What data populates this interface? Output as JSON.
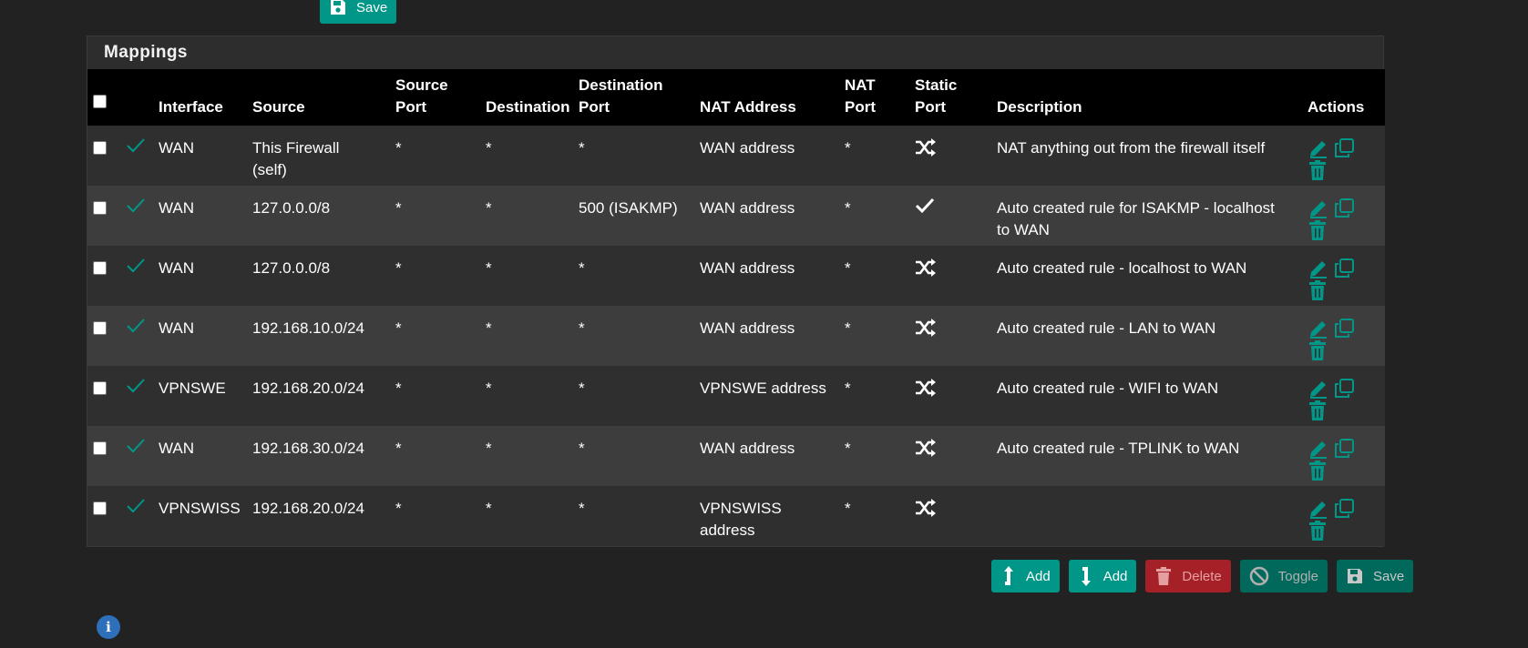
{
  "top_save": {
    "label": "Save"
  },
  "panel": {
    "title": "Mappings"
  },
  "columns": {
    "interface": "Interface",
    "source": "Source",
    "source_port": [
      "Source",
      "Port"
    ],
    "destination": "Destination",
    "destination_port": [
      "Destination",
      "Port"
    ],
    "nat_address": "NAT Address",
    "nat_port": [
      "NAT",
      "Port"
    ],
    "static_port": [
      "Static",
      "Port"
    ],
    "description": "Description",
    "actions": "Actions"
  },
  "rows": [
    {
      "interface": "WAN",
      "source": [
        "This Firewall",
        "(self)"
      ],
      "source_port": "*",
      "destination": "*",
      "destination_port": "*",
      "nat_address": [
        "WAN address"
      ],
      "nat_port": "*",
      "static_port_icon": "shuffle-icon",
      "description": [
        "NAT anything out from the firewall itself"
      ]
    },
    {
      "interface": "WAN",
      "source": [
        "127.0.0.0/8"
      ],
      "source_port": "*",
      "destination": "*",
      "destination_port": "500 (ISAKMP)",
      "nat_address": [
        "WAN address"
      ],
      "nat_port": "*",
      "static_port_icon": "check-icon",
      "description": [
        "Auto created rule for ISAKMP - localhost",
        "to WAN"
      ]
    },
    {
      "interface": "WAN",
      "source": [
        "127.0.0.0/8"
      ],
      "source_port": "*",
      "destination": "*",
      "destination_port": "*",
      "nat_address": [
        "WAN address"
      ],
      "nat_port": "*",
      "static_port_icon": "shuffle-icon",
      "description": [
        "Auto created rule - localhost to WAN"
      ]
    },
    {
      "interface": "WAN",
      "source": [
        "192.168.10.0/24"
      ],
      "source_port": "*",
      "destination": "*",
      "destination_port": "*",
      "nat_address": [
        "WAN address"
      ],
      "nat_port": "*",
      "static_port_icon": "shuffle-icon",
      "description": [
        "Auto created rule - LAN to WAN"
      ]
    },
    {
      "interface": "VPNSWE",
      "source": [
        "192.168.20.0/24"
      ],
      "source_port": "*",
      "destination": "*",
      "destination_port": "*",
      "nat_address": [
        "VPNSWE address"
      ],
      "nat_port": "*",
      "static_port_icon": "shuffle-icon",
      "description": [
        "Auto created rule - WIFI to WAN"
      ]
    },
    {
      "interface": "WAN",
      "source": [
        "192.168.30.0/24"
      ],
      "source_port": "*",
      "destination": "*",
      "destination_port": "*",
      "nat_address": [
        "WAN address"
      ],
      "nat_port": "*",
      "static_port_icon": "shuffle-icon",
      "description": [
        "Auto created rule - TPLINK to WAN"
      ]
    },
    {
      "interface": "VPNSWISS",
      "source": [
        "192.168.20.0/24"
      ],
      "source_port": "*",
      "destination": "*",
      "destination_port": "*",
      "nat_address": [
        "VPNSWISS",
        "address"
      ],
      "nat_port": "*",
      "static_port_icon": "shuffle-icon",
      "description": []
    }
  ],
  "bottom_buttons": {
    "add_top": "Add",
    "add_bottom": "Add",
    "delete": "Delete",
    "toggle": "Toggle",
    "save": "Save"
  },
  "colors": {
    "accent": "#009688",
    "danger": "#a52127",
    "background": "#222222",
    "info": "#2d6fb8"
  }
}
